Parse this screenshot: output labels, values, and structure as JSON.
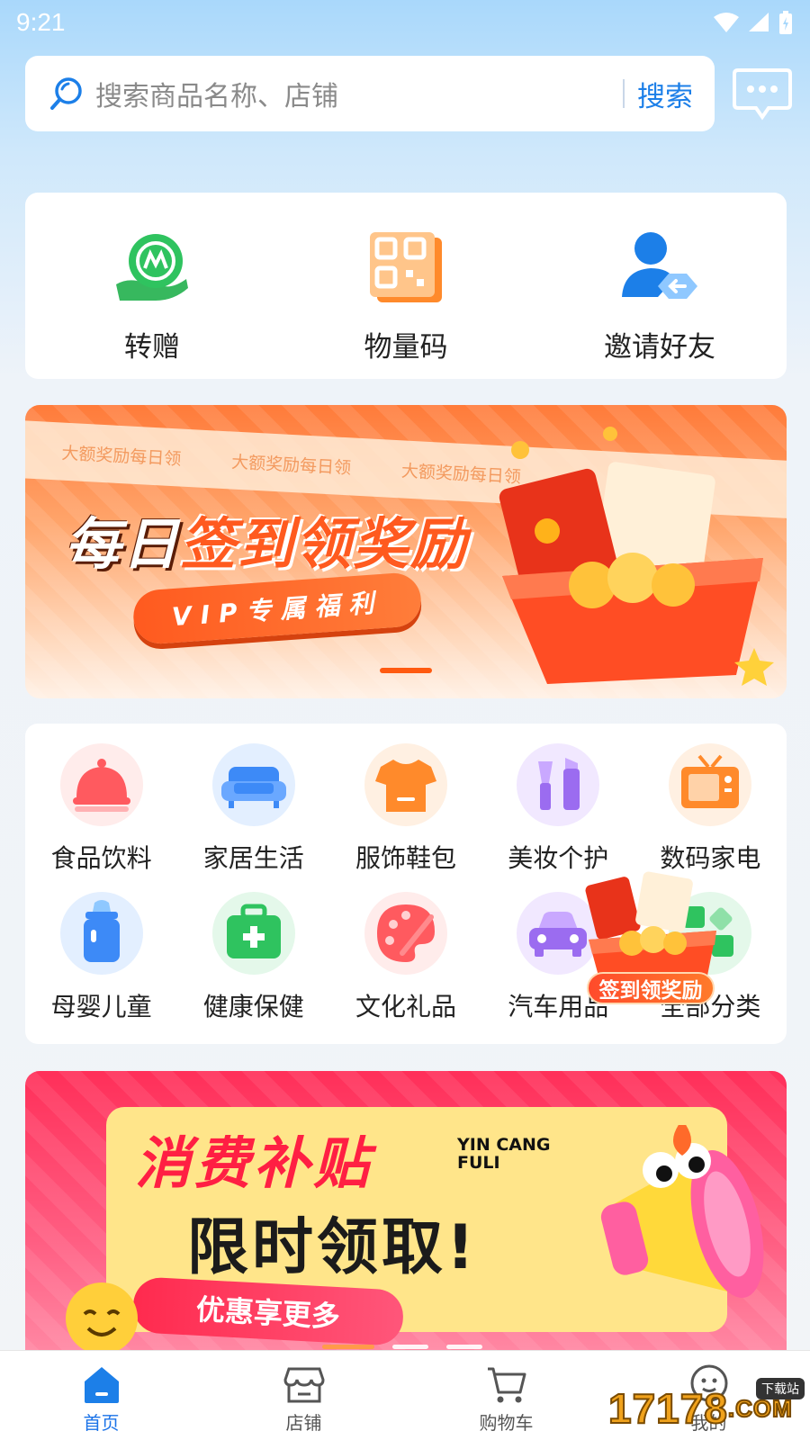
{
  "status_bar": {
    "time": "9:21"
  },
  "search": {
    "placeholder": "搜索商品名称、店铺",
    "button_label": "搜索"
  },
  "quick_actions": [
    {
      "label": "转赠",
      "icon": "transfer-icon"
    },
    {
      "label": "物量码",
      "icon": "qr-code-icon"
    },
    {
      "label": "邀请好友",
      "icon": "invite-user-icon"
    }
  ],
  "banner_signin": {
    "strip_texts": [
      "大额奖励每日领",
      "大额奖励每日领",
      "大额奖励每日领"
    ],
    "title_part1": "每日",
    "title_part2": "签到领奖励",
    "pill": "VIP专属福利"
  },
  "categories": [
    {
      "label": "食品饮料",
      "icon": "food-cloche-icon",
      "color": "#ff5a5f"
    },
    {
      "label": "家居生活",
      "icon": "sofa-icon",
      "color": "#3d8af7"
    },
    {
      "label": "服饰鞋包",
      "icon": "tshirt-icon",
      "color": "#ff8a2b"
    },
    {
      "label": "美妆个护",
      "icon": "makeup-icon",
      "color": "#9b6cf0"
    },
    {
      "label": "数码家电",
      "icon": "tv-icon",
      "color": "#ff8a2b"
    },
    {
      "label": "母婴儿童",
      "icon": "baby-bottle-icon",
      "color": "#3d8af7"
    },
    {
      "label": "健康保健",
      "icon": "medical-kit-icon",
      "color": "#2fc35f"
    },
    {
      "label": "文化礼品",
      "icon": "palette-icon",
      "color": "#ff5a5f"
    },
    {
      "label": "汽车用品",
      "icon": "car-icon",
      "color": "#9b6cf0"
    },
    {
      "label": "全部分类",
      "icon": "all-categories-icon",
      "color": "#2fc35f"
    }
  ],
  "float_promo": {
    "label": "签到领奖励"
  },
  "banner_subsidy": {
    "title1": "消费补贴",
    "english": "YIN CANG FULI",
    "title2": "限时领取!",
    "pill": "优惠享更多"
  },
  "tabs": [
    {
      "label": "首页",
      "icon": "home-icon",
      "active": true
    },
    {
      "label": "店铺",
      "icon": "store-icon",
      "active": false
    },
    {
      "label": "购物车",
      "icon": "cart-icon",
      "active": false
    },
    {
      "label": "我的",
      "icon": "profile-icon",
      "active": false
    }
  ],
  "watermark": {
    "number": "17178",
    "tag": "下载站",
    "domain": ".COM"
  },
  "colors": {
    "accent_blue": "#1c7fe8",
    "banner_orange": "#ff5a1f",
    "banner_red": "#ff2f59"
  }
}
